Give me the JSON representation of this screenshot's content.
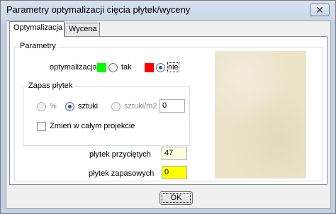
{
  "window": {
    "title": "Parametry optymalizacji cięcia płytek/wyceny",
    "close_label": "✕"
  },
  "tabs": [
    {
      "label": "Optymalizacja",
      "active": true
    },
    {
      "label": "Wycena",
      "active": false
    }
  ],
  "parametry": {
    "group_label": "Parametry",
    "optimization_label": "optymalizacja",
    "option_yes": {
      "label": "tak",
      "color": "#00ff00",
      "checked": false
    },
    "option_no": {
      "label": "nie",
      "color": "#ff0000",
      "checked": true
    },
    "zapas": {
      "group_label": "Zapas płytek",
      "option_percent": {
        "label": "%",
        "checked": false,
        "enabled": false
      },
      "option_pieces": {
        "label": "sztuki",
        "checked": true,
        "enabled": true
      },
      "option_per_m2": {
        "label": "sztuki/m2",
        "checked": false,
        "enabled": false
      },
      "value": "0",
      "change_all_label": "Zmień w całym projekcie",
      "change_all_checked": false
    },
    "cut_tiles_label": "płytek przyciętych",
    "cut_tiles_value": "47",
    "spare_tiles_label": "płytek zapasowych",
    "spare_tiles_value": "0",
    "cut_tiles_bg": "#ffffe1",
    "spare_tiles_bg": "#ffff00"
  },
  "ok_label": "OK"
}
